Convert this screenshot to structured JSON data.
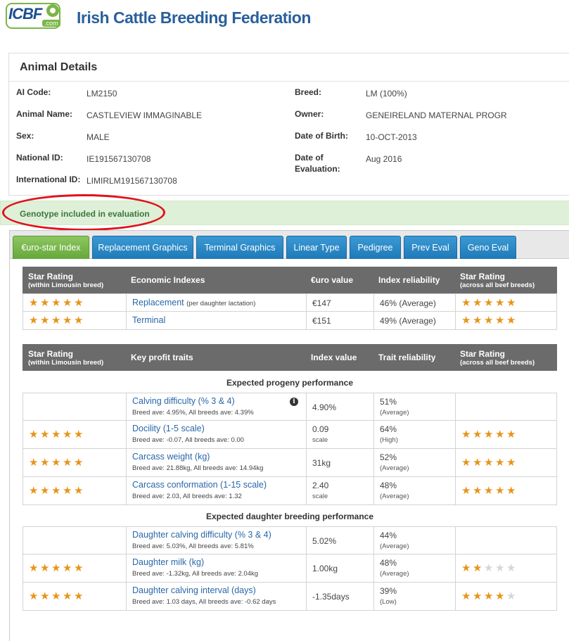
{
  "header": {
    "logo_text": "ICBF",
    "logo_sub": ".com",
    "title": "Irish Cattle Breeding Federation"
  },
  "details": {
    "title": "Animal Details",
    "left": [
      {
        "label": "AI Code:",
        "value": "LM2150"
      },
      {
        "label": "Animal Name:",
        "value": "CASTLEVIEW IMMAGINABLE"
      },
      {
        "label": "Sex:",
        "value": "MALE"
      },
      {
        "label": "National ID:",
        "value": "IE191567130708"
      },
      {
        "label": "International ID:",
        "value": "LIMIRLM191567130708"
      }
    ],
    "right": [
      {
        "label": "Breed:",
        "value": "LM (100%)"
      },
      {
        "label": "Owner:",
        "value": "GENEIRELAND MATERNAL PROGR"
      },
      {
        "label": "Date of Birth:",
        "value": "10-OCT-2013"
      },
      {
        "label": "Date of",
        "label2": "Evaluation:",
        "value": "Aug 2016"
      }
    ]
  },
  "alert": "Genotype included in evaluation",
  "tabs": [
    {
      "label": "€uro-star Index",
      "active": true
    },
    {
      "label": "Replacement Graphics"
    },
    {
      "label": "Terminal Graphics"
    },
    {
      "label": "Linear Type"
    },
    {
      "label": "Pedigree"
    },
    {
      "label": "Prev Eval"
    },
    {
      "label": "Geno Eval"
    }
  ],
  "economic": {
    "headers": {
      "stars": "Star Rating",
      "stars_sub": "(within Limousin breed)",
      "name": "Economic Indexes",
      "value": "€uro value",
      "rel": "Index reliability",
      "stars2": "Star Rating",
      "stars2_sub": "(across all beef breeds)"
    },
    "rows": [
      {
        "stars": 5,
        "name": "Replacement",
        "note": "(per daughter lactation)",
        "value": "€147",
        "rel": "46% (Average)",
        "stars2": 5
      },
      {
        "stars": 5,
        "name": "Terminal",
        "note": "",
        "value": "€151",
        "rel": "49% (Average)",
        "stars2": 5
      }
    ]
  },
  "traits": {
    "headers": {
      "stars": "Star Rating",
      "stars_sub": "(within Limousin breed)",
      "name": "Key profit traits",
      "value": "Index value",
      "rel": "Trait reliability",
      "stars2": "Star Rating",
      "stars2_sub": "(across all beef breeds)"
    },
    "section1": "Expected progeny performance",
    "section2": "Expected daughter breeding performance",
    "progeny": [
      {
        "stars": 0,
        "name": "Calving difficulty (% 3 & 4)",
        "sub": "Breed ave: 4.95%, All breeds ave: 4.39%",
        "value": "4.90%",
        "unit": "",
        "rel": "51%",
        "rel_sub": "(Average)",
        "stars2": 0,
        "info": "i"
      },
      {
        "stars": 5,
        "name": "Docility (1-5 scale)",
        "sub": "Breed ave: -0.07, All breeds ave: 0.00",
        "value": "0.09",
        "unit": "scale",
        "rel": "64%",
        "rel_sub": "(High)",
        "stars2": 5
      },
      {
        "stars": 5,
        "name": "Carcass weight (kg)",
        "sub": "Breed ave: 21.88kg, All breeds ave: 14.94kg",
        "value": "31kg",
        "unit": "",
        "rel": "52%",
        "rel_sub": "(Average)",
        "stars2": 5
      },
      {
        "stars": 5,
        "name": "Carcass conformation (1-15 scale)",
        "sub": "Breed ave: 2.03, All breeds ave: 1.32",
        "value": "2.40",
        "unit": "scale",
        "rel": "48%",
        "rel_sub": "(Average)",
        "stars2": 5
      }
    ],
    "daughter": [
      {
        "stars": 0,
        "name": "Daughter calving difficulty (% 3 & 4)",
        "sub": "Breed ave: 5.03%, All breeds ave: 5.81%",
        "value": "5.02%",
        "unit": "",
        "rel": "44%",
        "rel_sub": "(Average)",
        "stars2": 0
      },
      {
        "stars": 5,
        "name": "Daughter milk (kg)",
        "sub": "Breed ave: -1.32kg, All breeds ave: 2.04kg",
        "value": "1.00kg",
        "unit": "",
        "rel": "48%",
        "rel_sub": "(Average)",
        "stars2": 2
      },
      {
        "stars": 5,
        "name": "Daughter calving interval (days)",
        "sub": "Breed ave: 1.03 days, All breeds ave: -0.62 days",
        "value": "-1.35days",
        "unit": "",
        "rel": "39%",
        "rel_sub": "(Low)",
        "stars2": 4
      }
    ]
  },
  "colors": {
    "star_on": "#e6951b",
    "star_off": "#d6d6d6",
    "tab_blue": "#2a8ac8",
    "tab_active": "#74b349",
    "alert_bg": "#dff0d8",
    "alert_text": "#3c763d",
    "highlight": "#e0111a"
  }
}
